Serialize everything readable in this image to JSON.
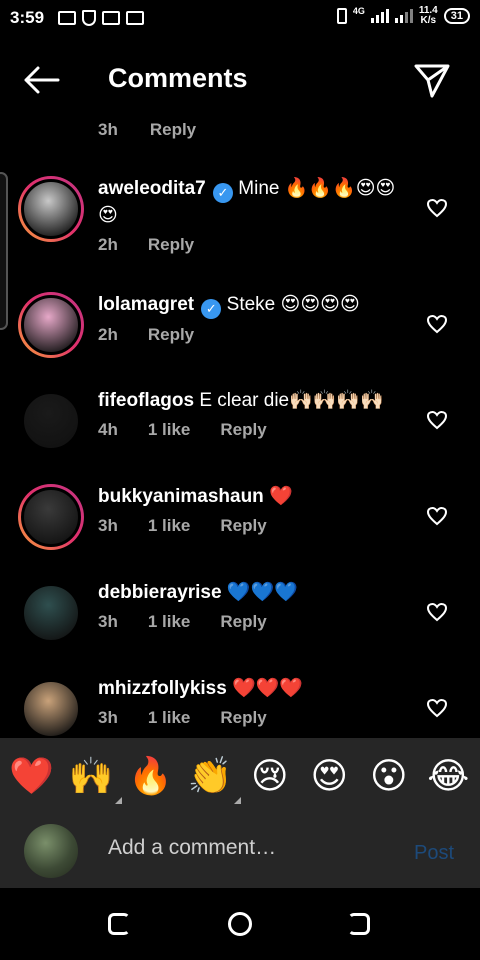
{
  "status_bar": {
    "time": "3:59",
    "network_type": "4G",
    "speed_value": "11.4",
    "speed_unit": "K/s",
    "battery": "31"
  },
  "header": {
    "title": "Comments"
  },
  "partial_comment": {
    "age": "3h",
    "reply_label": "Reply"
  },
  "comments": [
    {
      "username": "aweleodita7",
      "verified": true,
      "text": "Mine 🔥🔥🔥😍😍😍",
      "age": "2h",
      "likes": "",
      "reply_label": "Reply",
      "avatar_color": "#c8c8c8",
      "ring": true
    },
    {
      "username": "lolamagret",
      "verified": true,
      "text": "Steke 😍😍😍😍",
      "age": "2h",
      "likes": "",
      "reply_label": "Reply",
      "avatar_color": "#e6a8c8",
      "ring": true
    },
    {
      "username": "fifeoflagos",
      "verified": false,
      "text": "E clear die🙌🏻🙌🏻🙌🏻🙌🏻",
      "age": "4h",
      "likes": "1 like",
      "reply_label": "Reply",
      "avatar_color": "#1a1a1a",
      "ring": false
    },
    {
      "username": "bukkyanimashaun",
      "verified": false,
      "text": "❤️",
      "age": "3h",
      "likes": "1 like",
      "reply_label": "Reply",
      "avatar_color": "#3a3a3a",
      "ring": true
    },
    {
      "username": "debbierayrise",
      "verified": false,
      "text": "💙💙💙",
      "age": "3h",
      "likes": "1 like",
      "reply_label": "Reply",
      "avatar_color": "#2f4f4f",
      "ring": false
    },
    {
      "username": "mhizzfollykiss",
      "verified": false,
      "text": "❤️❤️❤️",
      "age": "3h",
      "likes": "1 like",
      "reply_label": "Reply",
      "avatar_color": "#c9a27a",
      "ring": false
    }
  ],
  "emoji_bar": [
    "❤️",
    "🙌",
    "🔥",
    "👏",
    "😢",
    "😍",
    "😮",
    "😂"
  ],
  "input": {
    "placeholder": "Add a comment…",
    "post_label": "Post"
  },
  "colors": {
    "accent_link": "#1d4a7a",
    "verified": "#3897f0",
    "meta": "#a8a8a8",
    "surface": "#262626"
  }
}
